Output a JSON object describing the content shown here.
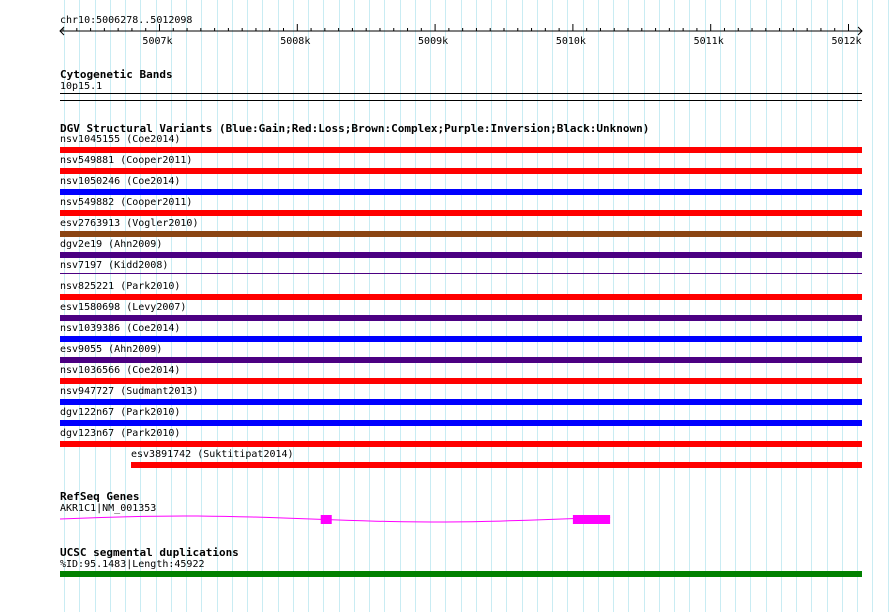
{
  "ruler": {
    "position": "chr10:5006278..5012098",
    "start": 5006278,
    "end": 5012098,
    "ticks": [
      {
        "pos": 5007000,
        "label": "5007k"
      },
      {
        "pos": 5008000,
        "label": "5008k"
      },
      {
        "pos": 5009000,
        "label": "5009k"
      },
      {
        "pos": 5010000,
        "label": "5010k"
      },
      {
        "pos": 5011000,
        "label": "5011k"
      },
      {
        "pos": 5012000,
        "label": "5012k"
      }
    ]
  },
  "cytobands": {
    "title": "Cytogenetic Bands",
    "band": "10p15.1"
  },
  "dgv": {
    "title": "DGV Structural Variants (Blue:Gain;Red:Loss;Brown:Complex;Purple:Inversion;Black:Unknown)",
    "colors": {
      "gain": "#0000ff",
      "loss": "#ff0000",
      "complex": "#8b4513",
      "inversion": "#4b0082"
    },
    "variants": [
      {
        "label": "nsv1045155 (Coe2014)",
        "type": "loss",
        "start": 5006278,
        "end": 5012098
      },
      {
        "label": "nsv549881 (Cooper2011)",
        "type": "loss",
        "start": 5006278,
        "end": 5012098
      },
      {
        "label": "nsv1050246 (Coe2014)",
        "type": "gain",
        "start": 5006278,
        "end": 5012098
      },
      {
        "label": "nsv549882 (Cooper2011)",
        "type": "loss",
        "start": 5006278,
        "end": 5012098
      },
      {
        "label": "esv2763913 (Vogler2010)",
        "type": "complex",
        "start": 5006278,
        "end": 5012098
      },
      {
        "label": "dgv2e19 (Ahn2009)",
        "type": "inversion",
        "start": 5006278,
        "end": 5012098
      },
      {
        "label": "nsv7197 (Kidd2008)",
        "type": "inversion",
        "start": 5006278,
        "end": 5012098,
        "thin": true
      },
      {
        "label": "nsv825221 (Park2010)",
        "type": "loss",
        "start": 5006278,
        "end": 5012098
      },
      {
        "label": "esv1580698 (Levy2007)",
        "type": "inversion",
        "start": 5006278,
        "end": 5012098
      },
      {
        "label": "nsv1039386 (Coe2014)",
        "type": "gain",
        "start": 5006278,
        "end": 5012098
      },
      {
        "label": "esv9055 (Ahn2009)",
        "type": "inversion",
        "start": 5006278,
        "end": 5012098
      },
      {
        "label": "nsv1036566 (Coe2014)",
        "type": "loss",
        "start": 5006278,
        "end": 5012098
      },
      {
        "label": "nsv947727 (Sudmant2013)",
        "type": "gain",
        "start": 5006278,
        "end": 5012098
      },
      {
        "label": "dgv122n67 (Park2010)",
        "type": "gain",
        "start": 5006278,
        "end": 5012098
      },
      {
        "label": "dgv123n67 (Park2010)",
        "type": "loss",
        "start": 5006278,
        "end": 5012098
      },
      {
        "label": "esv3891742 (Suktitipat2014)",
        "type": "loss",
        "start": 5006795,
        "end": 5012098
      }
    ]
  },
  "refseq": {
    "title": "RefSeq Genes",
    "gene_label": "AKR1C1|NM_001353",
    "color": "#ff00ff",
    "exons": [
      {
        "start": 5008170,
        "end": 5008250
      },
      {
        "start": 5010000,
        "end": 5010270
      }
    ]
  },
  "segdups": {
    "title": "UCSC segmental duplications",
    "label": "%ID:95.1483|Length:45922",
    "color": "#008000",
    "start": 5006278,
    "end": 5012098
  }
}
